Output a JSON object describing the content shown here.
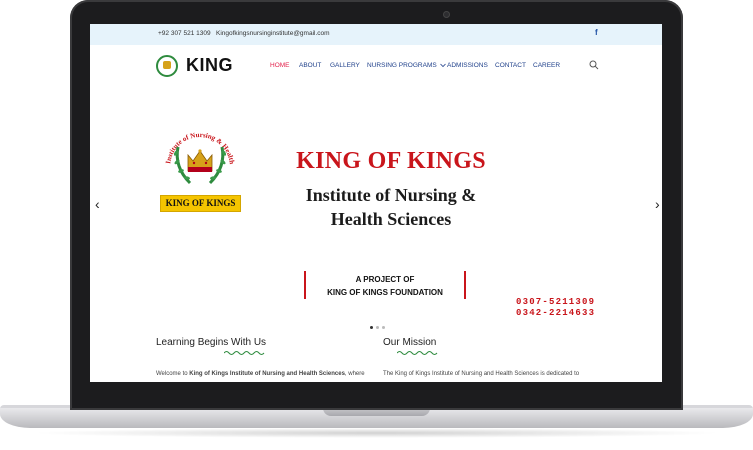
{
  "topbar": {
    "phone": "+92 307 521 1309",
    "email": "Kingofkingsnursinginstitute@gmail.com",
    "social_icon": "facebook-icon"
  },
  "header": {
    "logo_text": "KING",
    "nav": [
      {
        "label": "HOME",
        "active": true
      },
      {
        "label": "ABOUT"
      },
      {
        "label": "GALLERY"
      },
      {
        "label": "NURSING PROGRAMS"
      },
      {
        "label": "ADMISSIONS"
      },
      {
        "label": "CONTACT"
      },
      {
        "label": "CAREER"
      }
    ],
    "search_icon": "search-icon"
  },
  "hero": {
    "seal_ring_text": "Institute of Nursing & Health Sciences",
    "seal_label": "KING OF KINGS",
    "title": "KING OF KINGS",
    "subtitle_line1": "Institute of Nursing &",
    "subtitle_line2": "Health Sciences",
    "project_line1": "A PROJECT OF",
    "project_line2": "KING OF KINGS FOUNDATION",
    "phone1": "0307-5211309",
    "phone2": "0342-2214633",
    "prev_arrow": "‹",
    "next_arrow": "›",
    "slide_count": 3,
    "active_slide": 1
  },
  "sections": {
    "left_title": "Learning Begins With Us",
    "left_text_pre": "Welcome to ",
    "left_text_bold": "King of Kings Institute of Nursing and Health Sciences",
    "left_text_post": ", where",
    "right_title": "Our Mission",
    "right_text": "The King of Kings Institute of Nursing and Health Sciences is dedicated to"
  },
  "colors": {
    "accent_red": "#c9151b",
    "nav_blue": "#1e3f8a",
    "active_pink": "#e31f4a",
    "topbar_bg": "#e6f3fb",
    "squiggle_green": "#2e8b3e"
  }
}
